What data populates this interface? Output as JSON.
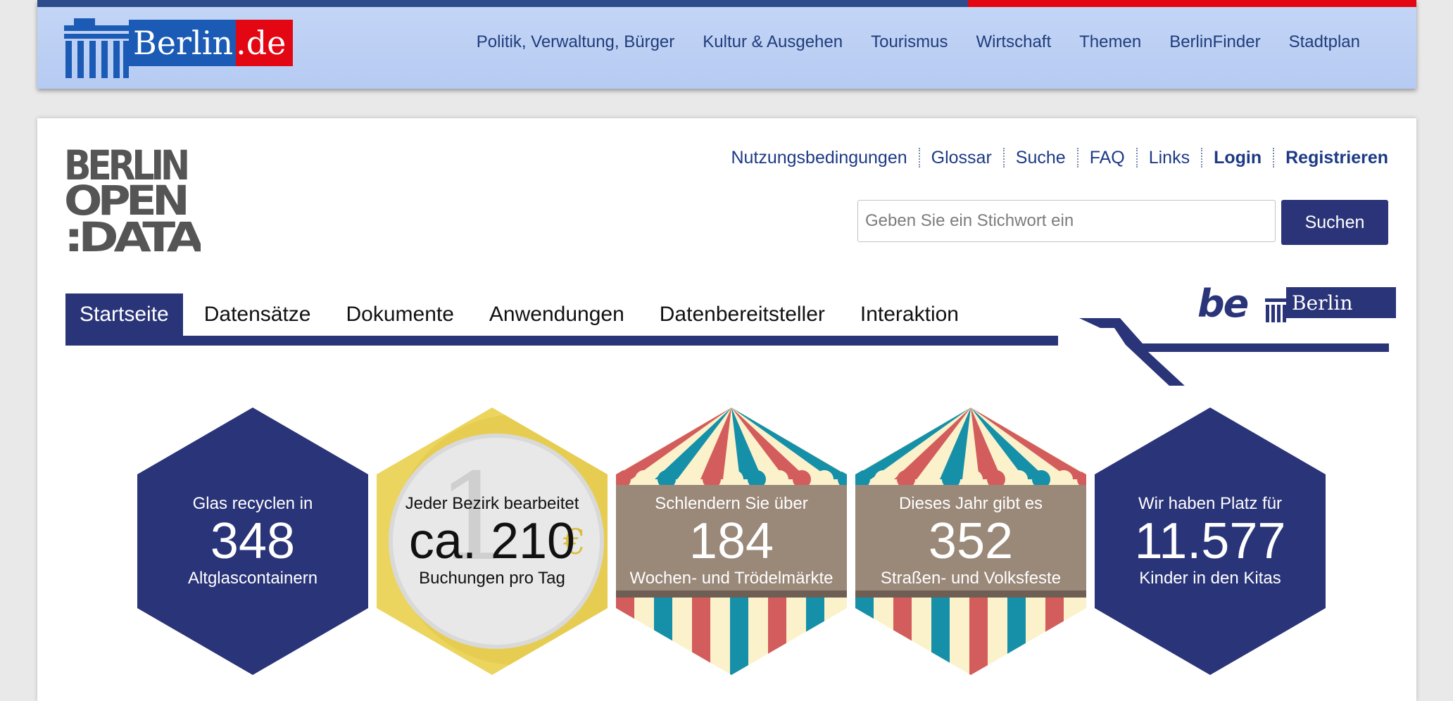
{
  "berlin_de": {
    "logo_word_1": "Berlin",
    "logo_word_2": ".de",
    "nav": [
      "Politik, Verwaltung, Bürger",
      "Kultur & Ausgehen",
      "Tourismus",
      "Wirtschaft",
      "Themen",
      "BerlinFinder",
      "Stadtplan"
    ]
  },
  "open_data": {
    "logo_text": "BERLIN OPEN DATA",
    "utility": [
      "Nutzungsbedingungen",
      "Glossar",
      "Suche",
      "FAQ",
      "Links",
      "Login",
      "Registrieren"
    ],
    "search": {
      "placeholder": "Geben Sie ein Stichwort ein",
      "button": "Suchen"
    },
    "tabs": [
      "Startseite",
      "Datensätze",
      "Dokumente",
      "Anwendungen",
      "Datenbereitsteller",
      "Interaktion"
    ],
    "active_tab": "Startseite",
    "be_berlin_logo": {
      "be": "be",
      "berlin": "Berlin"
    }
  },
  "hexagons": [
    {
      "style": "dark",
      "line1": "Glas recyclen in",
      "number": "348",
      "line2": "Altglascontainern"
    },
    {
      "style": "coin",
      "line1": "Jeder Bezirk bearbeitet",
      "number": "ca. 210",
      "line2": "Buchungen pro Tag"
    },
    {
      "style": "tent",
      "line1": "Schlendern Sie über",
      "number": "184",
      "line2": "Wochen- und Trödelmärkte"
    },
    {
      "style": "tent",
      "line1": "Dieses Jahr gibt es",
      "number": "352",
      "line2": "Straßen- und Volksfeste"
    },
    {
      "style": "dark",
      "line1": "Wir haben Platz für",
      "number": "11.577",
      "line2": "Kinder in den Kitas"
    }
  ],
  "colors": {
    "navy": "#2a3478",
    "berlin_blue": "#1b5bb5",
    "berlin_red": "#e30613",
    "coin_yellow": "#ecd55e",
    "tent_brown": "#9a8878",
    "stripe_red": "#d35d5c",
    "stripe_teal": "#1690a8",
    "stripe_cream": "#fbf2cc"
  }
}
